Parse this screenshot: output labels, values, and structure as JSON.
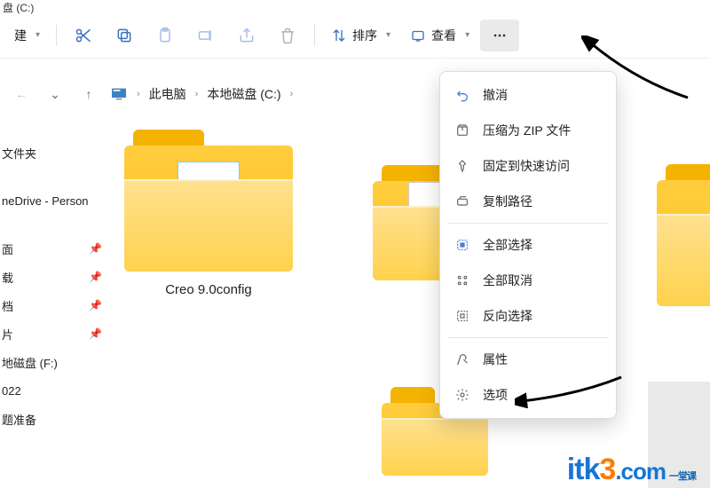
{
  "window": {
    "title_suffix": "盘 (C:)"
  },
  "toolbar": {
    "new_label_suffix": "建",
    "sort_label": "排序",
    "view_label": "查看"
  },
  "breadcrumb": {
    "items": [
      "此电脑",
      "本地磁盘 (C:)"
    ]
  },
  "sidebar": {
    "heading": "文件夹",
    "items": [
      {
        "label": "neDrive - Person",
        "pinned": false
      },
      {
        "label": "面",
        "pinned": true
      },
      {
        "label": "载",
        "pinned": true
      },
      {
        "label": "档",
        "pinned": true
      },
      {
        "label": "片",
        "pinned": true
      },
      {
        "label": "地磁盘 (F:)",
        "pinned": false
      },
      {
        "label": "022",
        "pinned": false
      },
      {
        "label": "题准备",
        "pinned": false
      }
    ]
  },
  "files": [
    {
      "name": "Creo 9.0config",
      "icon": "folder-with-chart"
    },
    {
      "name": "",
      "icon": "folder-with-doc"
    },
    {
      "name": "",
      "icon": "folder-plain"
    },
    {
      "name": "",
      "icon": "folder-plain"
    }
  ],
  "context_menu": {
    "items": [
      {
        "icon": "undo-icon",
        "label": "撤消"
      },
      {
        "icon": "zip-icon",
        "label": "压缩为 ZIP 文件"
      },
      {
        "icon": "pin-icon",
        "label": "固定到快速访问"
      },
      {
        "icon": "copy-path-icon",
        "label": "复制路径"
      },
      {
        "sep": true
      },
      {
        "icon": "select-all-icon",
        "label": "全部选择"
      },
      {
        "icon": "deselect-icon",
        "label": "全部取消"
      },
      {
        "icon": "invert-select-icon",
        "label": "反向选择"
      },
      {
        "sep": true
      },
      {
        "icon": "properties-icon",
        "label": "属性"
      },
      {
        "icon": "options-icon",
        "label": "选项"
      }
    ]
  },
  "watermark": {
    "part1": "itk",
    "part2": "3",
    "part3": ".com",
    "tagline1": "一堂课",
    "tagline2": ""
  }
}
